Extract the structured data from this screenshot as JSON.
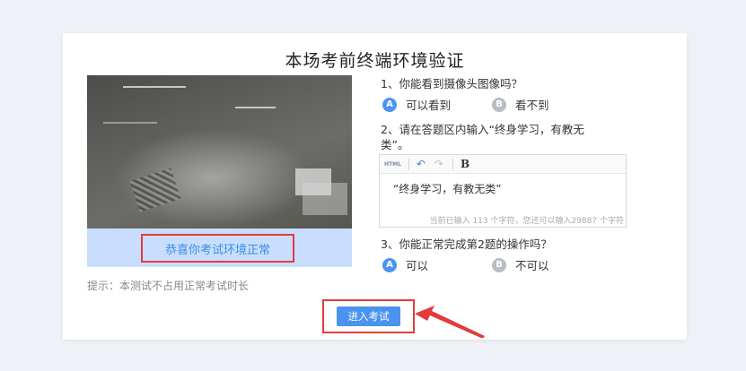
{
  "title": "本场考前终端环境验证",
  "camera_status": "恭喜你考试环境正常",
  "tip": "提示：本测试不占用正常考试时长",
  "questions": [
    {
      "text": "1、你能看到摄像头图像吗？",
      "options": [
        {
          "badge": "A",
          "label": "可以看到",
          "selected": true
        },
        {
          "badge": "B",
          "label": "看不到",
          "selected": false
        }
      ]
    },
    {
      "text_line1": "2、请在答题区内输入“终身学习，有教无",
      "text_line2": "类”。",
      "editor": {
        "toolbar": {
          "html": "HTML",
          "undo": "↶",
          "redo": "↷",
          "bold": "B"
        },
        "content": "“终身学习，有教无类”",
        "count": "当前已输入 113 个字符，您还可以输入29887 个字符"
      }
    },
    {
      "text": "3、你能正常完成第2题的操作吗？",
      "options": [
        {
          "badge": "A",
          "label": "可以",
          "selected": true
        },
        {
          "badge": "B",
          "label": "不可以",
          "selected": false
        }
      ]
    }
  ],
  "enter_button": "进入考试",
  "colors": {
    "accent": "#4a93ef",
    "highlight": "#e23b3b",
    "status_bg": "#c9deff"
  }
}
